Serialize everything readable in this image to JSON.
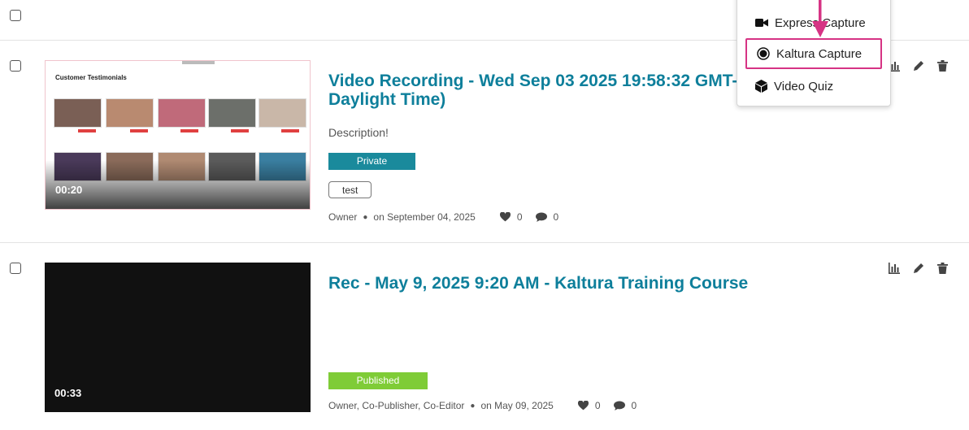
{
  "dropdown": {
    "items": [
      {
        "label": "Express Capture",
        "icon": "video-camera-icon"
      },
      {
        "label": "Kaltura Capture",
        "icon": "record-icon",
        "highlighted": true
      },
      {
        "label": "Video Quiz",
        "icon": "cube-icon"
      }
    ],
    "highlight_color": "#d63384"
  },
  "entries": [
    {
      "title_line1": "Video Recording - Wed Sep 03 2025 19:58:32 GMT-0",
      "title_line2": "Daylight Time)",
      "description": "Description!",
      "status": "Private",
      "status_color": "#1a8a9c",
      "tag": "test",
      "thumbnail_heading": "Customer Testimonials",
      "duration": "00:20",
      "owner": "Owner",
      "date": "on September 04, 2025",
      "likes": "0",
      "comments": "0"
    },
    {
      "title_line1": "Rec - May 9, 2025 9:20 AM - Kaltura Training Course",
      "status": "Published",
      "status_color": "#7fcc37",
      "duration": "00:33",
      "owner": "Owner, Co-Publisher, Co-Editor",
      "date": "on May 09, 2025",
      "likes": "0",
      "comments": "0"
    }
  ],
  "colors": {
    "title": "#0e7f9b",
    "arrow": "#d63384"
  }
}
